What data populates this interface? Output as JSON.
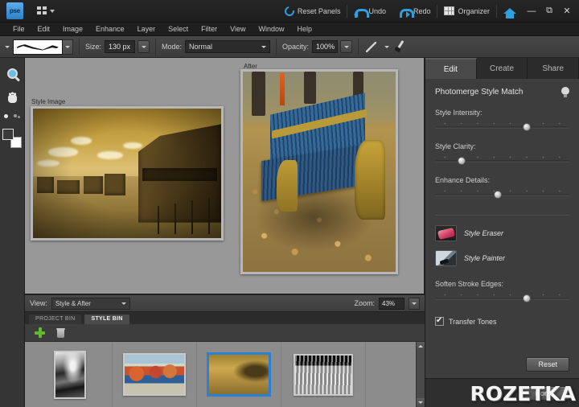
{
  "titlebar": {
    "logo_text": "pse",
    "layout_icon": "grid-layout-icon",
    "actions": [
      {
        "label": "Reset Panels",
        "icon": "reset-icon"
      },
      {
        "label": "Undo",
        "icon": "undo-arrow-icon"
      },
      {
        "label": "Redo",
        "icon": "redo-arrow-icon"
      },
      {
        "label": "Organizer",
        "icon": "organizer-grid-icon"
      }
    ],
    "home_icon": "home-icon",
    "window_controls": {
      "minimize": "—",
      "restore": "⧉",
      "close": "✕"
    }
  },
  "menubar": {
    "items": [
      "File",
      "Edit",
      "Image",
      "Enhance",
      "Layer",
      "Select",
      "Filter",
      "View",
      "Window",
      "Help"
    ]
  },
  "optionsbar": {
    "brush_preview_name": "brush-stroke-preview",
    "size_label": "Size:",
    "size_value": "130 px",
    "mode_label": "Mode:",
    "mode_value": "Normal",
    "opacity_label": "Opacity:",
    "opacity_value": "100%",
    "tablet_icon": "tablet-pressure-icon",
    "brush_tool_icon": "brush-tool-icon"
  },
  "toolbar": {
    "tools": [
      {
        "name": "zoom-tool",
        "icon": "magnifier-icon"
      },
      {
        "name": "hand-tool",
        "icon": "hand-icon"
      }
    ],
    "foreground_color": "#3a3a3a",
    "background_color": "#ffffff"
  },
  "canvas": {
    "style_image_label": "Style Image",
    "after_label": "After",
    "style_image_alt": "sepia western ghost town with wooden buildings",
    "after_image_alt": "park bench with blue slats and yellow iron ends on autumn leaves"
  },
  "viewbar": {
    "view_label": "View:",
    "view_value": "Style & After",
    "zoom_label": "Zoom:",
    "zoom_value": "43%"
  },
  "bin": {
    "tabs": [
      {
        "label": "PROJECT BIN",
        "active": false
      },
      {
        "label": "STYLE BIN",
        "active": true
      }
    ],
    "add_icon": "plus-icon",
    "delete_icon": "trash-icon",
    "thumbnails": [
      {
        "name": "thumb-bw-rocks",
        "alt": "black and white rocky shoreline",
        "selected": false
      },
      {
        "name": "thumb-market",
        "alt": "colorful market truck scene",
        "selected": false
      },
      {
        "name": "thumb-sepia-town",
        "alt": "sepia western town",
        "selected": true
      },
      {
        "name": "thumb-bw-architecture",
        "alt": "black and white architectural figures",
        "selected": false
      }
    ]
  },
  "panel": {
    "tabs": [
      {
        "label": "Edit",
        "active": true
      },
      {
        "label": "Create",
        "active": false
      },
      {
        "label": "Share",
        "active": false
      }
    ],
    "title": "Photomerge Style Match",
    "help_icon": "lightbulb-icon",
    "sliders": [
      {
        "label": "Style Intensity:",
        "value": 68
      },
      {
        "label": "Style Clarity:",
        "value": 20
      },
      {
        "label": "Enhance Details:",
        "value": 47
      }
    ],
    "tools": [
      {
        "label": "Style Eraser",
        "icon": "eraser-icon"
      },
      {
        "label": "Style Painter",
        "icon": "painter-icon"
      }
    ],
    "soften_label": "Soften Stroke Edges:",
    "soften_value": 68,
    "transfer_tones_label": "Transfer Tones",
    "transfer_tones_checked": true,
    "reset_label": "Reset",
    "done_label": "Done"
  },
  "watermark": {
    "text": "ROZETKA"
  }
}
